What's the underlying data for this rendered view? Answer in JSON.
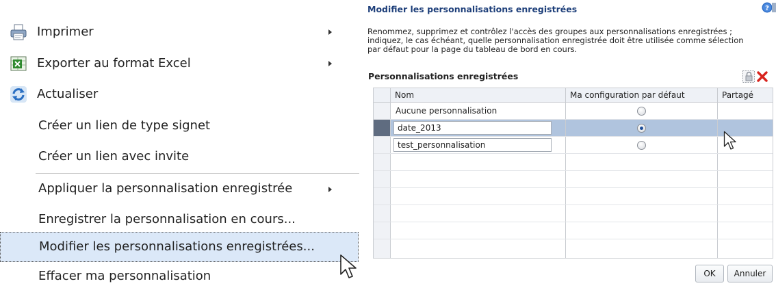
{
  "context_menu": {
    "items": [
      {
        "label": "Imprimer",
        "icon": "printer-icon",
        "has_submenu": true
      },
      {
        "label": "Exporter au format Excel",
        "icon": "excel-icon",
        "has_submenu": true
      },
      {
        "label": "Actualiser",
        "icon": "refresh-icon",
        "has_submenu": false
      },
      {
        "label": "Créer un lien de type signet",
        "has_submenu": false
      },
      {
        "label": "Créer un lien avec invite",
        "has_submenu": false
      },
      {
        "label": "Appliquer la personnalisation enregistrée",
        "has_submenu": true
      },
      {
        "label": "Enregistrer la personnalisation en cours...",
        "has_submenu": false
      },
      {
        "label": "Modifier les personnalisations enregistrées...",
        "has_submenu": false,
        "highlighted": true
      },
      {
        "label": "Effacer ma personnalisation",
        "has_submenu": false
      }
    ]
  },
  "dialog": {
    "title": "Modifier les personnalisations enregistrées",
    "description_lines": [
      "Renommez, supprimez et contrôlez l'accès des groupes aux personnalisations enregistrées ;",
      "indiquez, le cas échéant, quelle personnalisation enregistrée doit être utilisée comme sélection",
      "par défaut pour la page du tableau de bord en cours."
    ],
    "section_title": "Personnalisations enregistrées",
    "table": {
      "columns": [
        "Nom",
        "Ma configuration par défaut",
        "Partagé"
      ],
      "rows": [
        {
          "name": "Aucune personnalisation",
          "editable": false,
          "default": false,
          "selected": false
        },
        {
          "name": "date_2013",
          "editable": true,
          "default": true,
          "selected": true
        },
        {
          "name": "test_personnalisation",
          "editable": true,
          "default": false,
          "selected": false
        }
      ]
    },
    "ok_label": "OK",
    "cancel_label": "Annuler"
  },
  "colors": {
    "title": "#1e3f7a",
    "selected_row": "#b0c4de",
    "menu_highlight": "#dbe8f8",
    "delete_icon": "#d8231d"
  }
}
